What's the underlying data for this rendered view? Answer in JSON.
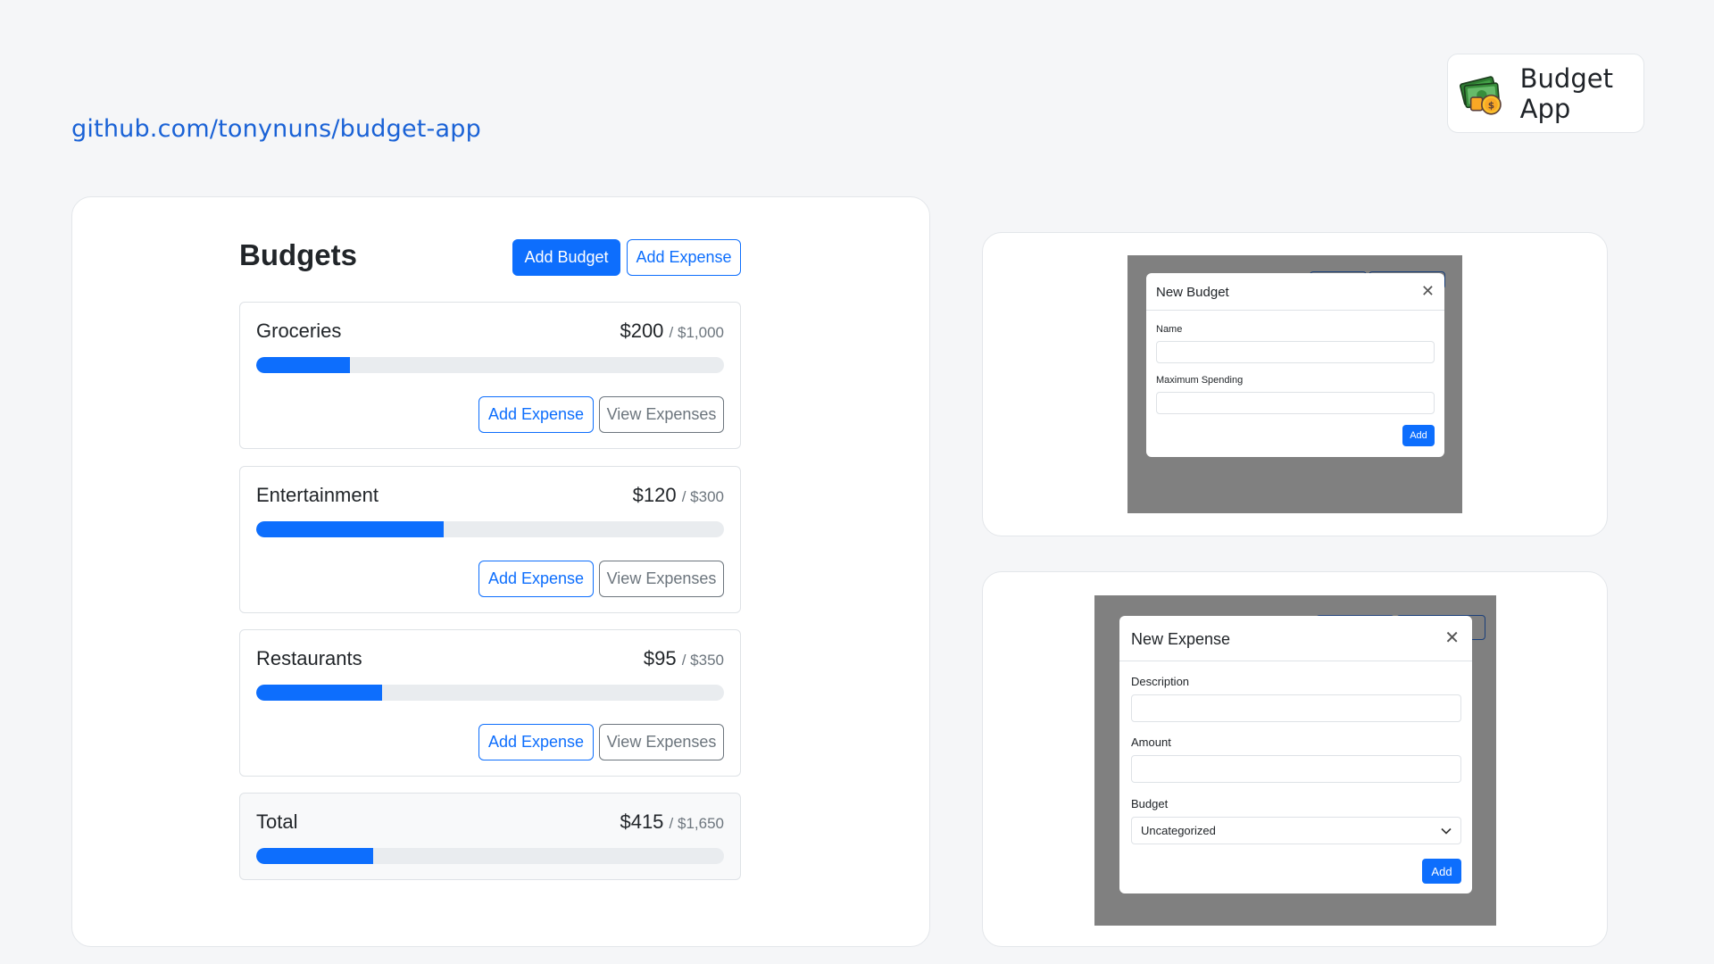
{
  "repo_link": "github.com/tonynuns/budget-app",
  "brand": {
    "name": "Budget App",
    "logo_icon": "money-stack-icon"
  },
  "budgets_view": {
    "title": "Budgets",
    "add_budget_label": "Add Budget",
    "add_expense_label": "Add Expense",
    "budgets": [
      {
        "name": "Groceries",
        "amount": "$200",
        "max": "/ $1,000",
        "progress": 0.2,
        "add_expense_label": "Add Expense",
        "view_expenses_label": "View Expenses"
      },
      {
        "name": "Entertainment",
        "amount": "$120",
        "max": "/ $300",
        "progress": 0.4,
        "add_expense_label": "Add Expense",
        "view_expenses_label": "View Expenses"
      },
      {
        "name": "Restaurants",
        "amount": "$95",
        "max": "/ $350",
        "progress": 0.27,
        "add_expense_label": "Add Expense",
        "view_expenses_label": "View Expenses"
      }
    ],
    "total": {
      "name": "Total",
      "amount": "$415",
      "max": "/ $1,650",
      "progress": 0.25
    }
  },
  "new_budget_modal": {
    "title": "New Budget",
    "name_label": "Name",
    "name_value": "",
    "max_label": "Maximum Spending",
    "max_value": "",
    "submit_label": "Add"
  },
  "new_expense_modal": {
    "title": "New Expense",
    "description_label": "Description",
    "description_value": "",
    "amount_label": "Amount",
    "amount_value": "",
    "budget_label": "Budget",
    "budget_selected": "Uncategorized",
    "submit_label": "Add"
  },
  "colors": {
    "primary": "#0d6efd",
    "secondary": "#6c757d",
    "link": "#1a62d6",
    "overlay": "#808080"
  }
}
